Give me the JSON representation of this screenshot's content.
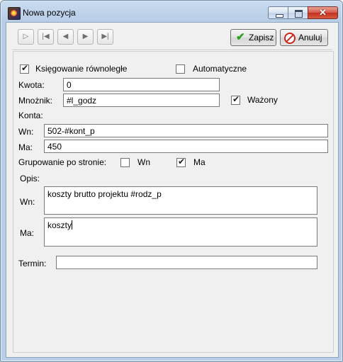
{
  "window": {
    "title": "Nowa pozycja",
    "icon": "app-icon"
  },
  "toolbar": {
    "nav_buttons": [
      "first-record-icon",
      "prev-record-icon",
      "next-record-icon",
      "last-record-icon"
    ],
    "save_label": "Zapisz",
    "cancel_label": "Anuluj"
  },
  "form": {
    "parallel_label": "Księgowanie równoległe",
    "parallel_checked": true,
    "auto_label": "Automatyczne",
    "auto_checked": false,
    "kwota_label": "Kwota:",
    "kwota_value": "0",
    "mnoznik_label": "Mnożnik:",
    "mnoznik_value": "#l_godz",
    "wazony_label": "Ważony",
    "wazony_checked": true,
    "konta_label": "Konta:",
    "wn_label": "Wn:",
    "wn_value": "502-#kont_p",
    "ma_label": "Ma:",
    "ma_value": "450",
    "group_label": "Grupowanie po stronie:",
    "group_wn_label": "Wn",
    "group_wn_checked": false,
    "group_ma_label": "Ma",
    "group_ma_checked": true,
    "opis_label": "Opis:",
    "opis_wn_label": "Wn:",
    "opis_wn_value": "koszty brutto projektu #rodz_p",
    "opis_ma_label": "Ma:",
    "opis_ma_value": "koszty",
    "termin_label": "Termin:",
    "termin_value": ""
  },
  "colors": {
    "title_bar": "#b9cfe7",
    "close_button": "#c2321f",
    "save_icon": "#2aa21c",
    "cancel_icon": "#c8281c"
  }
}
